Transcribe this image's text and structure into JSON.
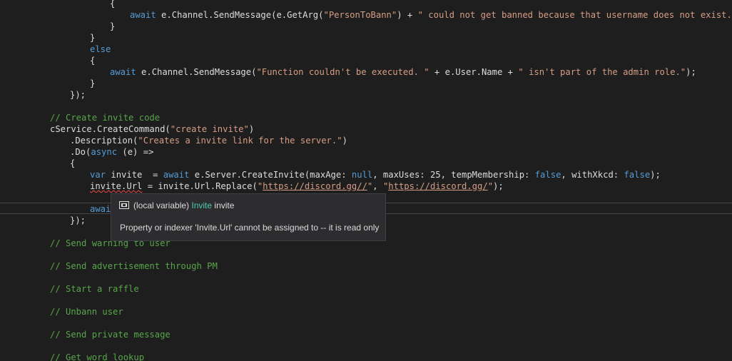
{
  "editor": {
    "l1": {
      "brace": "{"
    },
    "l2": {
      "await": "await",
      "a": " e.Channel.SendMessage(e.GetArg(",
      "s1": "\"PersonToBann\"",
      "b": ") + ",
      "s2": "\" could not get banned because that username does not exist.\"",
      "c": ");"
    },
    "l3": {
      "brace": "}"
    },
    "l4": {
      "brace": "}"
    },
    "l5": {
      "else": "else"
    },
    "l6": {
      "brace": "{"
    },
    "l7": {
      "await": "await",
      "a": " e.Channel.SendMessage(",
      "s1": "\"Function couldn't be executed. \"",
      "b": " + e.User.Name + ",
      "s2": "\" isn't part of the admin role.\"",
      "c": ");"
    },
    "l8": {
      "brace": "}"
    },
    "l9": {
      "text": "});"
    },
    "l10": {
      "comment": "// Create invite code"
    },
    "l11": {
      "a": "cService.CreateCommand(",
      "s1": "\"create invite\"",
      "b": ")"
    },
    "l12": {
      "a": ".Description(",
      "s1": "\"Creates a invite link for the server.\"",
      "b": ")"
    },
    "l13": {
      "a": ".Do(",
      "async": "async",
      "b": " (e) =>"
    },
    "l14": {
      "brace": "{"
    },
    "l15": {
      "var": "var",
      "a": " invite  = ",
      "await": "await",
      "b": " e.Server.CreateInvite(maxAge: ",
      "null": "null",
      "c": ", maxUses: 25, tempMembership: ",
      "false1": "false",
      "d": ", withXkcd: ",
      "false2": "false",
      "e": ");"
    },
    "l16": {
      "err": "invite.Url",
      "a": " = invite.Url.Replace(",
      "q1": "\"",
      "url1": "https://discord.gg//",
      "q2": "\"",
      "sep": ", ",
      "q3": "\"",
      "url2": "https://discord.gg/",
      "q4": "\"",
      "c": ");"
    },
    "l18": {
      "await": "awai"
    },
    "l19": {
      "text": "});"
    },
    "l20": {
      "comment": "// Send warning to user"
    },
    "l22": {
      "comment": "// Send advertisement through PM"
    },
    "l24": {
      "comment": "// Start a raffle"
    },
    "l26": {
      "comment": "// Unbann user"
    },
    "l28": {
      "comment": "// Send private message"
    },
    "l30": {
      "comment": "// Get word lookup"
    }
  },
  "tooltip": {
    "icon": "local-variable-icon",
    "prefix": "(local variable) ",
    "type": "Invite",
    "name": " invite",
    "message": "Property or indexer 'Invite.Url' cannot be assigned to -- it is read only"
  },
  "colors": {
    "background": "#1e1e1e",
    "keyword": "#569cd6",
    "string": "#d69d85",
    "comment": "#57a64a",
    "type": "#4ec9b0",
    "error": "#f44747"
  }
}
